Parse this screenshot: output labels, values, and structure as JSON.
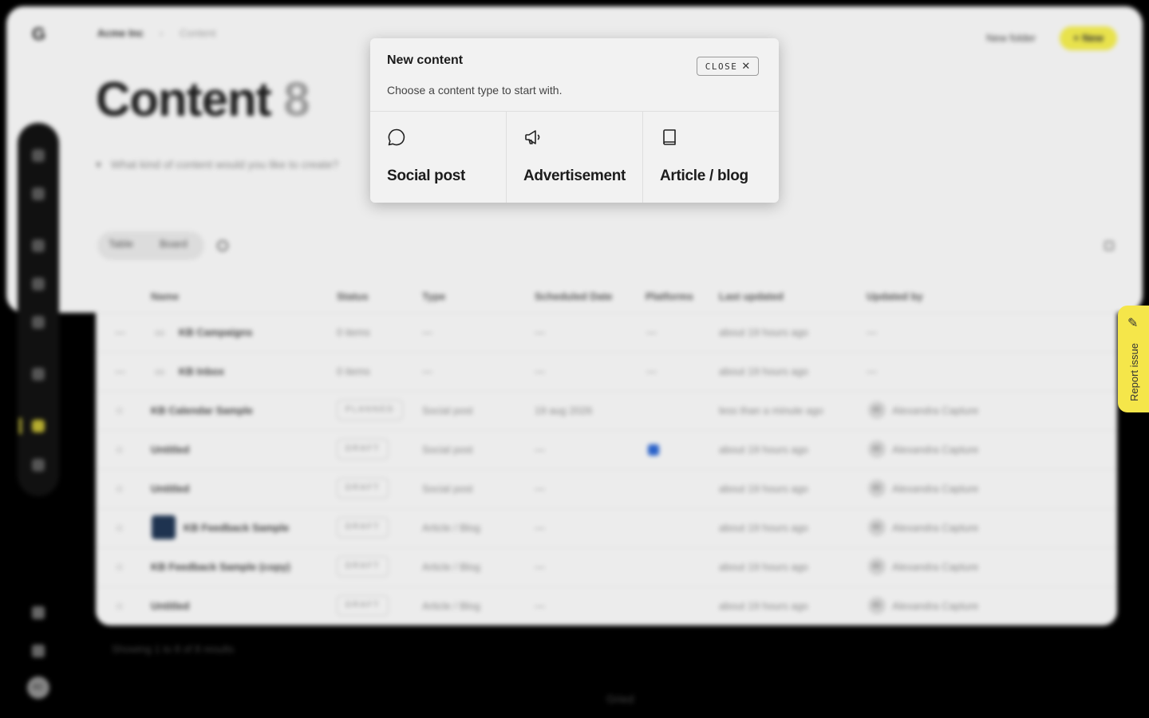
{
  "app": {
    "logo": "G",
    "breadcrumb": {
      "org": "Acme Inc",
      "separator": "›",
      "current": "Content"
    },
    "page_title": "Content",
    "page_count": "8",
    "prompt_placeholder": "What kind of content would you like to create?",
    "actions": {
      "new_folder": "New folder",
      "new": "+ New"
    },
    "view_tabs": [
      {
        "label": "Table"
      },
      {
        "label": "Board"
      }
    ],
    "table": {
      "columns": [
        "Name",
        "Status",
        "Type",
        "Scheduled Date",
        "Platforms",
        "Last updated",
        "Updated by"
      ],
      "rows": [
        {
          "name": "KB Campaigns",
          "status": "0 items",
          "type": "—",
          "date": "—",
          "platforms": "—",
          "updated": "about 19 hours ago",
          "by": "—",
          "kind": "folder"
        },
        {
          "name": "KB Inbox",
          "status": "0 items",
          "type": "—",
          "date": "—",
          "platforms": "—",
          "updated": "about 19 hours ago",
          "by": "—",
          "kind": "folder"
        },
        {
          "name": "KB Calendar Sample",
          "status": "PLANNED",
          "type": "Social post",
          "date": "19 aug 2026",
          "platforms": "",
          "updated": "less than a minute ago",
          "by": "Alexandra Capture",
          "kind": "item"
        },
        {
          "name": "Untitled",
          "status": "DRAFT",
          "type": "Social post",
          "date": "—",
          "platforms": "",
          "updated": "about 19 hours ago",
          "by": "Alexandra Capture",
          "kind": "item"
        },
        {
          "name": "Untitled",
          "status": "DRAFT",
          "type": "Social post",
          "date": "—",
          "platforms": "",
          "updated": "about 19 hours ago",
          "by": "Alexandra Capture",
          "kind": "item"
        },
        {
          "name": "KB Feedback Sample",
          "status": "DRAFT",
          "type": "Article / Blog",
          "date": "—",
          "platforms": "",
          "updated": "about 19 hours ago",
          "by": "Alexandra Capture",
          "kind": "item"
        },
        {
          "name": "KB Feedback Sample (copy)",
          "status": "DRAFT",
          "type": "Article / Blog",
          "date": "—",
          "platforms": "",
          "updated": "about 19 hours ago",
          "by": "Alexandra Capture",
          "kind": "item"
        },
        {
          "name": "Untitled",
          "status": "DRAFT",
          "type": "Article / Blog",
          "date": "—",
          "platforms": "",
          "updated": "about 19 hours ago",
          "by": "Alexandra Capture",
          "kind": "item"
        }
      ]
    },
    "showing": "Showing 1 to 8 of 8 results",
    "footer_brand": "Gried",
    "user_initials": "AC",
    "avatar_initials": "AC"
  },
  "report_issue": {
    "label": "Report issue",
    "icon": "pencil-icon"
  },
  "modal": {
    "title": "New content",
    "subtitle": "Choose a content type to start with.",
    "close_label": "CLOSE",
    "close_icon": "✕",
    "options": [
      {
        "label": "Social post",
        "icon": "speech-bubble-icon"
      },
      {
        "label": "Advertisement",
        "icon": "megaphone-icon"
      },
      {
        "label": "Article / blog",
        "icon": "book-icon"
      }
    ]
  },
  "colors": {
    "accent": "#e8e24c",
    "modal_bg": "#f2f2f2",
    "backdrop": "#000000"
  }
}
